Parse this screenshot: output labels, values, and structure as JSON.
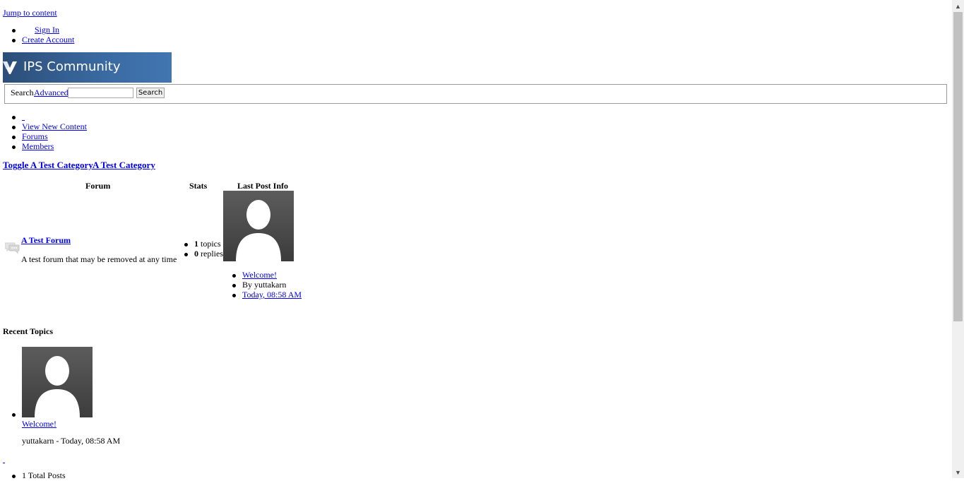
{
  "skip_link": "Jump to content",
  "user_nav": {
    "sign_in": "Sign In",
    "create_account": "Create Account"
  },
  "logo": {
    "text": "IPS Community"
  },
  "search": {
    "label": "Search",
    "advanced": "Advanced",
    "query": "",
    "button": "Search"
  },
  "main_nav": {
    "items": [
      "View New Content",
      "Forums",
      "Members"
    ]
  },
  "category": {
    "toggle": "Toggle A Test Category",
    "title": "A Test Category"
  },
  "forum_table": {
    "headers": {
      "forum": "Forum",
      "stats": "Stats",
      "last_post": "Last Post Info"
    },
    "forum": {
      "name": "A Test Forum",
      "description": "A test forum that may be removed at any time"
    },
    "stats": {
      "topics_count": "1",
      "topics_label": "topics",
      "replies_count": "0",
      "replies_label": "replies"
    },
    "last_post": {
      "title": "Welcome!",
      "author": "By yuttakarn",
      "date": "Today, 08:58 AM"
    }
  },
  "recent_topics": {
    "heading": "Recent Topics",
    "items": [
      {
        "title": "Welcome!",
        "meta": "yuttakarn - Today, 08:58 AM"
      }
    ]
  },
  "stats_footer": {
    "total_posts": "1 Total Posts"
  },
  "colors": {
    "link": "#0000ee",
    "logo_bg": "#3a6aa2"
  }
}
